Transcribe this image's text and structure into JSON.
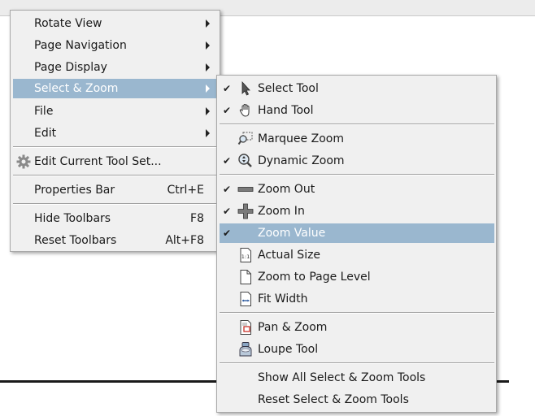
{
  "main_menu": {
    "items": [
      {
        "label": "Rotate View",
        "submenu": true
      },
      {
        "label": "Page Navigation",
        "submenu": true
      },
      {
        "label": "Page Display",
        "submenu": true
      },
      {
        "label": "Select & Zoom",
        "submenu": true,
        "highlighted": true
      },
      {
        "label": "File",
        "submenu": true
      },
      {
        "label": "Edit",
        "submenu": true
      },
      {
        "label": "Edit Current Tool Set...",
        "icon": "gear-icon"
      },
      {
        "label": "Properties Bar",
        "shortcut": "Ctrl+E"
      },
      {
        "label": "Hide Toolbars",
        "shortcut": "F8"
      },
      {
        "label": "Reset Toolbars",
        "shortcut": "Alt+F8"
      }
    ]
  },
  "submenu": {
    "items": [
      {
        "label": "Select Tool",
        "checked": true,
        "icon": "select-arrow-icon"
      },
      {
        "label": "Hand Tool",
        "checked": true,
        "icon": "hand-icon"
      },
      {
        "label": "Marquee Zoom",
        "checked": false,
        "icon": "marquee-zoom-icon"
      },
      {
        "label": "Dynamic Zoom",
        "checked": true,
        "icon": "dynamic-zoom-icon"
      },
      {
        "label": "Zoom Out",
        "checked": true,
        "icon": "minus-icon"
      },
      {
        "label": "Zoom In",
        "checked": true,
        "icon": "plus-icon"
      },
      {
        "label": "Zoom Value",
        "checked": true,
        "highlighted": true
      },
      {
        "label": "Actual Size",
        "checked": false,
        "icon": "actual-size-icon"
      },
      {
        "label": "Zoom to Page Level",
        "checked": false,
        "icon": "page-icon"
      },
      {
        "label": "Fit Width",
        "checked": false,
        "icon": "fit-width-icon"
      },
      {
        "label": "Pan & Zoom",
        "checked": false,
        "icon": "pan-zoom-icon"
      },
      {
        "label": "Loupe Tool",
        "checked": false,
        "icon": "loupe-icon"
      },
      {
        "label": "Show All Select & Zoom Tools"
      },
      {
        "label": "Reset Select & Zoom Tools"
      }
    ]
  },
  "icons": {
    "check": "✔",
    "actual_size_text": "1:1"
  },
  "colors": {
    "highlight": "#9ab7cf",
    "menu_bg": "#f0f0f0"
  }
}
